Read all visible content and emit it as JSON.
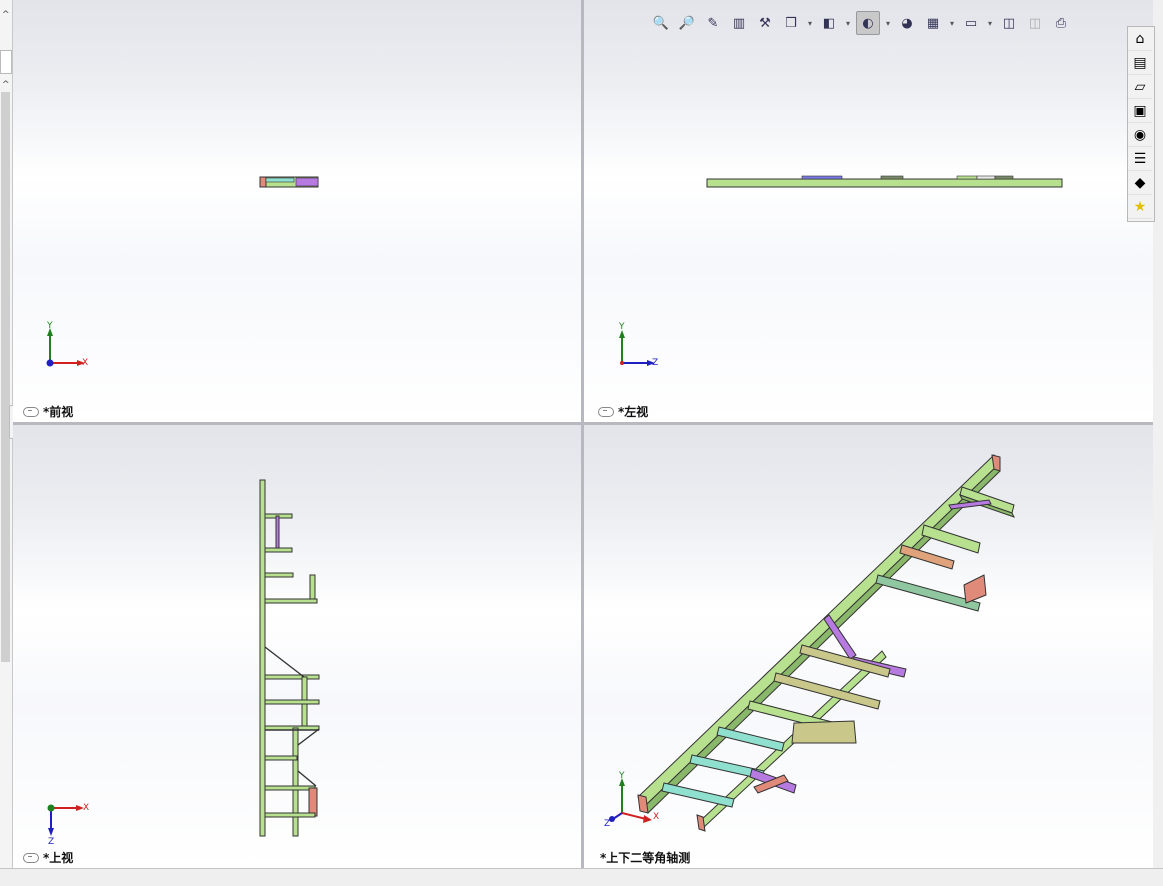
{
  "viewports": {
    "front": {
      "label": "*前视",
      "axes": [
        "Y",
        "X"
      ]
    },
    "left": {
      "label": "*左视",
      "axes": [
        "Y",
        "Z"
      ]
    },
    "top": {
      "label": "*上视",
      "axes": [
        "X",
        "Z"
      ]
    },
    "iso": {
      "label": "*上下二等角轴测",
      "axes": [
        "Y",
        "Z",
        "X"
      ]
    }
  },
  "toolbar": {
    "items": [
      "zoom-to-fit-icon",
      "zoom-to-area-icon",
      "previous-view-icon",
      "section-view-icon",
      "dynamic-annotation-icon",
      "view-orientation-icon",
      "display-style-icon",
      "hide-show-items-icon",
      "edit-appearance-icon",
      "apply-scene-icon",
      "view-settings-icon",
      "display-pane-icon",
      "camera-icon"
    ]
  },
  "taskpane": {
    "items": [
      "home-icon",
      "design-library-icon",
      "file-explorer-icon",
      "view-palette-icon",
      "appearances-icon",
      "custom-properties-icon",
      "tutorials-icon",
      "favorites-icon"
    ]
  },
  "colors": {
    "beam_green": "#b7e08f",
    "beam_purple": "#b77ae0",
    "beam_red": "#e08a7a",
    "beam_cyan": "#8fe0cf",
    "beam_olive": "#c9c88a",
    "axis_red": "#d02020",
    "axis_green": "#208020",
    "axis_blue": "#2020c0"
  }
}
